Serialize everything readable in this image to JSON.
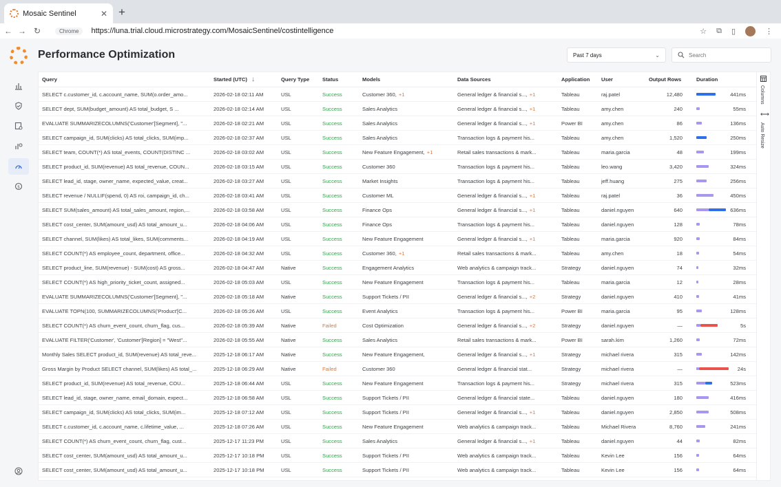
{
  "browser": {
    "tab_title": "Mosaic Sentinel",
    "chip": "Chrome",
    "url": "https://luna.trial.cloud.microstrategy.com/MosaicSentinel/costintelligence"
  },
  "page": {
    "title": "Performance Optimization",
    "filter_value": "Past 7 days",
    "search_placeholder": "Search"
  },
  "side": {
    "columns_label": "Columns",
    "auto_resize_label": "Auto Resize"
  },
  "columns": {
    "query": "Query",
    "started": "Started (UTC)",
    "query_type": "Query Type",
    "status": "Status",
    "models": "Models",
    "data_sources": "Data Sources",
    "application": "Application",
    "user": "User",
    "output_rows": "Output Rows",
    "duration": "Duration"
  },
  "colors": {
    "bar_blue": "#2f6fe8",
    "bar_purple": "#a996f0",
    "bar_red": "#e8534a",
    "success": "#2fa24a",
    "failed": "#e8742a"
  },
  "rows": [
    {
      "query": "SELECT c.customer_id, c.account_name, SUM(o.order_amo...",
      "started": "2026-02-18 02:11 AM",
      "type": "USL",
      "status": "Success",
      "model": "Customer 360,",
      "model_plus": "+1",
      "source": "General ledger & financial s...,",
      "source_plus": "+1",
      "app": "Tableau",
      "user": "raj.patel",
      "rows": "12,480",
      "duration": "441ms",
      "bar": [
        {
          "w": 0.55,
          "c": "blue"
        }
      ]
    },
    {
      "query": "SELECT dept, SUM(budget_amount) AS total_budget, S ...",
      "started": "2026-02-18 02:14 AM",
      "type": "USL",
      "status": "Success",
      "model": "Sales Analytics",
      "model_plus": "",
      "source": "General ledger & financial s...,",
      "source_plus": "+1",
      "app": "Tableau",
      "user": "amy.chen",
      "rows": "240",
      "duration": "55ms",
      "bar": [
        {
          "w": 0.1,
          "c": "purple"
        }
      ]
    },
    {
      "query": "EVALUATE SUMMARIZECOLUMNS('Customer'[Segment], \"...",
      "started": "2026-02-18 02:21 AM",
      "type": "USL",
      "status": "Success",
      "model": "Sales Analytics",
      "model_plus": "",
      "source": "General ledger & financial s...,",
      "source_plus": "+1",
      "app": "Power BI",
      "user": "amy.chen",
      "rows": "86",
      "duration": "136ms",
      "bar": [
        {
          "w": 0.15,
          "c": "purple"
        }
      ]
    },
    {
      "query": "SELECT campaign_id, SUM(clicks) AS total_clicks, SUM(imp...",
      "started": "2026-02-18 02:37 AM",
      "type": "USL",
      "status": "Success",
      "model": "Sales Analytics",
      "model_plus": "",
      "source": "Transaction logs & payment his...",
      "source_plus": "",
      "app": "Tableau",
      "user": "amy.chen",
      "rows": "1,520",
      "duration": "250ms",
      "bar": [
        {
          "w": 0.3,
          "c": "blue"
        }
      ]
    },
    {
      "query": "SELECT team, COUNT(*) AS total_events, COUNT(DISTINC ...",
      "started": "2026-02-18 03:02 AM",
      "type": "USL",
      "status": "Success",
      "model": "New Feature Engagement,",
      "model_plus": "+1",
      "source": "Retail sales transactions & mark...",
      "source_plus": "",
      "app": "Tableau",
      "user": "maria.garcia",
      "rows": "48",
      "duration": "199ms",
      "bar": [
        {
          "w": 0.22,
          "c": "purple"
        }
      ]
    },
    {
      "query": "SELECT product_id, SUM(revenue) AS total_revenue, COUN...",
      "started": "2026-02-18 03:15 AM",
      "type": "USL",
      "status": "Success",
      "model": "Customer 360",
      "model_plus": "",
      "source": "Transaction logs & payment his...",
      "source_plus": "",
      "app": "Tableau",
      "user": "leo.wang",
      "rows": "3,420",
      "duration": "324ms",
      "bar": [
        {
          "w": 0.35,
          "c": "purple"
        }
      ]
    },
    {
      "query": "SELECT lead_id, stage, owner_name, expected_value, creat...",
      "started": "2026-02-18 03:27 AM",
      "type": "USL",
      "status": "Success",
      "model": "Market Insights",
      "model_plus": "",
      "source": "Transaction logs & payment his...",
      "source_plus": "",
      "app": "Tableau",
      "user": "jeff.huang",
      "rows": "275",
      "duration": "256ms",
      "bar": [
        {
          "w": 0.3,
          "c": "purple"
        }
      ]
    },
    {
      "query": "SELECT revenue / NULLIF(spend, 0) AS roi, campaign_id, ch...",
      "started": "2026-02-18 03:41 AM",
      "type": "USL",
      "status": "Success",
      "model": "Customer ML",
      "model_plus": "",
      "source": "General ledger & financial s...,",
      "source_plus": "+1",
      "app": "Tableau",
      "user": "raj.patel",
      "rows": "36",
      "duration": "450ms",
      "bar": [
        {
          "w": 0.5,
          "c": "purple"
        }
      ]
    },
    {
      "query": "SELECT SUM(sales_amount) AS total_sales_amount, region,...",
      "started": "2026-02-18 03:58 AM",
      "type": "USL",
      "status": "Success",
      "model": "Finance Ops",
      "model_plus": "",
      "source": "General ledger & financial s...,",
      "source_plus": "+1",
      "app": "Tableau",
      "user": "daniel.nguyen",
      "rows": "640",
      "duration": "636ms",
      "bar": [
        {
          "w": 0.35,
          "c": "purple"
        },
        {
          "w": 0.5,
          "c": "blue"
        }
      ]
    },
    {
      "query": "SELECT cost_center, SUM(amount_usd) AS total_amount_u...",
      "started": "2026-02-18 04:06 AM",
      "type": "USL",
      "status": "Success",
      "model": "Finance Ops",
      "model_plus": "",
      "source": "Transaction logs & payment his...",
      "source_plus": "",
      "app": "Tableau",
      "user": "daniel.nguyen",
      "rows": "128",
      "duration": "78ms",
      "bar": [
        {
          "w": 0.1,
          "c": "purple"
        }
      ]
    },
    {
      "query": "SELECT channel, SUM(likes) AS total_likes, SUM(comments...",
      "started": "2026-02-18 04:19 AM",
      "type": "USL",
      "status": "Success",
      "model": "New Feature Engagement",
      "model_plus": "",
      "source": "General ledger & financial s...,",
      "source_plus": "+1",
      "app": "Tableau",
      "user": "maria.garcia",
      "rows": "920",
      "duration": "84ms",
      "bar": [
        {
          "w": 0.1,
          "c": "purple"
        }
      ]
    },
    {
      "query": "SELECT COUNT(*) AS employee_count, department, office...",
      "started": "2026-02-18 04:32 AM",
      "type": "USL",
      "status": "Success",
      "model": "Customer 360,",
      "model_plus": "+1",
      "source": "Retail sales transactions & mark...",
      "source_plus": "",
      "app": "Tableau",
      "user": "amy.chen",
      "rows": "18",
      "duration": "54ms",
      "bar": [
        {
          "w": 0.08,
          "c": "purple"
        }
      ]
    },
    {
      "query": "SELECT product_line, SUM(revenue) - SUM(cost) AS gross...",
      "started": "2026-02-18 04:47 AM",
      "type": "Native",
      "status": "Success",
      "model": "Engagement Analytics",
      "model_plus": "",
      "source": "Web analytics & campaign track...",
      "source_plus": "",
      "app": "Strategy",
      "user": "daniel.nguyen",
      "rows": "74",
      "duration": "32ms",
      "bar": [
        {
          "w": 0.06,
          "c": "purple"
        }
      ]
    },
    {
      "query": "SELECT COUNT(*) AS high_priority_ticket_count, assigned...",
      "started": "2026-02-18 05:03 AM",
      "type": "USL",
      "status": "Success",
      "model": "New Feature Engagement",
      "model_plus": "",
      "source": "Transaction logs & payment his...",
      "source_plus": "",
      "app": "Tableau",
      "user": "maria.garcia",
      "rows": "12",
      "duration": "28ms",
      "bar": [
        {
          "w": 0.06,
          "c": "purple"
        }
      ]
    },
    {
      "query": "EVALUATE SUMMARIZECOLUMNS('Customer'[Segment], \"...",
      "started": "2026-02-18 05:18 AM",
      "type": "Native",
      "status": "Success",
      "model": "Support Tickets / PII",
      "model_plus": "",
      "source": "General ledger & financial s...,",
      "source_plus": "+2",
      "app": "Strategy",
      "user": "daniel.nguyen",
      "rows": "410",
      "duration": "41ms",
      "bar": [
        {
          "w": 0.08,
          "c": "purple"
        }
      ]
    },
    {
      "query": "EVALUATE TOPN(100, SUMMARIZECOLUMNS('Product'[C...",
      "started": "2026-02-18 05:26 AM",
      "type": "USL",
      "status": "Success",
      "model": "Event Analytics",
      "model_plus": "",
      "source": "Transaction logs & payment his...",
      "source_plus": "",
      "app": "Power BI",
      "user": "maria.garcia",
      "rows": "95",
      "duration": "128ms",
      "bar": [
        {
          "w": 0.15,
          "c": "purple"
        }
      ]
    },
    {
      "query": "SELECT COUNT(*) AS churn_event_count, churn_flag, cus...",
      "started": "2026-02-18 05:39 AM",
      "type": "Native",
      "status": "Failed",
      "model": "Cost Optimization",
      "model_plus": "",
      "source": "General ledger & financial s...,",
      "source_plus": "+2",
      "app": "Strategy",
      "user": "daniel.nguyen",
      "rows": "—",
      "duration": "5s",
      "bar": [
        {
          "w": 0.12,
          "c": "purple"
        },
        {
          "w": 0.5,
          "c": "red"
        }
      ]
    },
    {
      "query": "EVALUATE FILTER('Customer', 'Customer'[Region] = \"West\"...",
      "started": "2026-02-18 05:55 AM",
      "type": "Native",
      "status": "Success",
      "model": "Sales Analytics",
      "model_plus": "",
      "source": "Retail sales transactions & mark...",
      "source_plus": "",
      "app": "Power BI",
      "user": "sarah.kim",
      "rows": "1,260",
      "duration": "72ms",
      "bar": [
        {
          "w": 0.1,
          "c": "purple"
        }
      ]
    },
    {
      "query": "Monthly Sales SELECT product_id, SUM(revenue) AS total_reve...",
      "started": "2025-12-18 06:17 AM",
      "type": "Native",
      "status": "Success",
      "model": "New Feature Engagement,",
      "model_plus": "",
      "source": "General ledger & financial s...,",
      "source_plus": "+1",
      "app": "Strategy",
      "user": "michael rivera",
      "rows": "315",
      "duration": "142ms",
      "bar": [
        {
          "w": 0.15,
          "c": "purple"
        }
      ]
    },
    {
      "query": "Gross Margin by Product SELECT channel, SUM(likes) AS total_...",
      "started": "2025-12-18 06:29 AM",
      "type": "Native",
      "status": "Failed",
      "model": "Customer 360",
      "model_plus": "",
      "source": "General ledger & financial stat...",
      "source_plus": "",
      "app": "Strategy",
      "user": "michael rivera",
      "rows": "—",
      "duration": "24s",
      "bar": [
        {
          "w": 0.08,
          "c": "purple"
        },
        {
          "w": 0.85,
          "c": "red"
        }
      ]
    },
    {
      "query": "SELECT product_id, SUM(revenue) AS total_revenue, COU...",
      "started": "2025-12-18 06:44 AM",
      "type": "USL",
      "status": "Success",
      "model": "New Feature Engagement",
      "model_plus": "",
      "source": "Transaction logs & payment his...",
      "source_plus": "",
      "app": "Strategy",
      "user": "michael rivera",
      "rows": "315",
      "duration": "523ms",
      "bar": [
        {
          "w": 0.25,
          "c": "purple"
        },
        {
          "w": 0.2,
          "c": "blue"
        }
      ]
    },
    {
      "query": "SELECT lead_id, stage, owner_name, email_domain, expect...",
      "started": "2025-12-18 06:58 AM",
      "type": "USL",
      "status": "Success",
      "model": "Support Tickets / PII",
      "model_plus": "",
      "source": "General ledger & financial state...",
      "source_plus": "",
      "app": "Tableau",
      "user": "daniel.nguyen",
      "rows": "180",
      "duration": "416ms",
      "bar": [
        {
          "w": 0.35,
          "c": "purple"
        }
      ]
    },
    {
      "query": "SELECT campaign_id, SUM(clicks) AS total_clicks, SUM(im...",
      "started": "2025-12-18 07:12 AM",
      "type": "USL",
      "status": "Success",
      "model": "Support Tickets / PII",
      "model_plus": "",
      "source": "General ledger & financial s...,",
      "source_plus": "+1",
      "app": "Tableau",
      "user": "daniel.nguyen",
      "rows": "2,850",
      "duration": "508ms",
      "bar": [
        {
          "w": 0.35,
          "c": "purple"
        }
      ]
    },
    {
      "query": "SELECT c.customer_id, c.account_name, c.lifetime_value, ...",
      "started": "2025-12-18 07:26 AM",
      "type": "USL",
      "status": "Success",
      "model": "New Feature Engagement",
      "model_plus": "",
      "source": "Web analytics & campaign track...",
      "source_plus": "",
      "app": "Tableau",
      "user": "Michael Rivera",
      "rows": "8,760",
      "duration": "241ms",
      "bar": [
        {
          "w": 0.25,
          "c": "purple"
        }
      ]
    },
    {
      "query": "SELECT COUNT(*) AS churn_event_count, churn_flag, cust...",
      "started": "2025-12-17 11:23 PM",
      "type": "USL",
      "status": "Success",
      "model": "Sales Analytics",
      "model_plus": "",
      "source": "General ledger & financial s...,",
      "source_plus": "+1",
      "app": "Tableau",
      "user": "daniel.nguyen",
      "rows": "44",
      "duration": "82ms",
      "bar": [
        {
          "w": 0.1,
          "c": "purple"
        }
      ]
    },
    {
      "query": "SELECT cost_center, SUM(amount_usd) AS total_amount_u...",
      "started": "2025-12-17 10:18 PM",
      "type": "USL",
      "status": "Success",
      "model": "Support Tickets / PII",
      "model_plus": "",
      "source": "Web analytics & campaign track...",
      "source_plus": "",
      "app": "Tableau",
      "user": "Kevin Lee",
      "rows": "156",
      "duration": "64ms",
      "bar": [
        {
          "w": 0.08,
          "c": "purple"
        }
      ]
    },
    {
      "query": "SELECT cost_center, SUM(amount_usd) AS total_amount_u...",
      "started": "2025-12-17 10:18 PM",
      "type": "USL",
      "status": "Success",
      "model": "Support Tickets / PII",
      "model_plus": "",
      "source": "Web analytics & campaign track...",
      "source_plus": "",
      "app": "Tableau",
      "user": "Kevin Lee",
      "rows": "156",
      "duration": "64ms",
      "bar": [
        {
          "w": 0.08,
          "c": "purple"
        }
      ]
    }
  ]
}
